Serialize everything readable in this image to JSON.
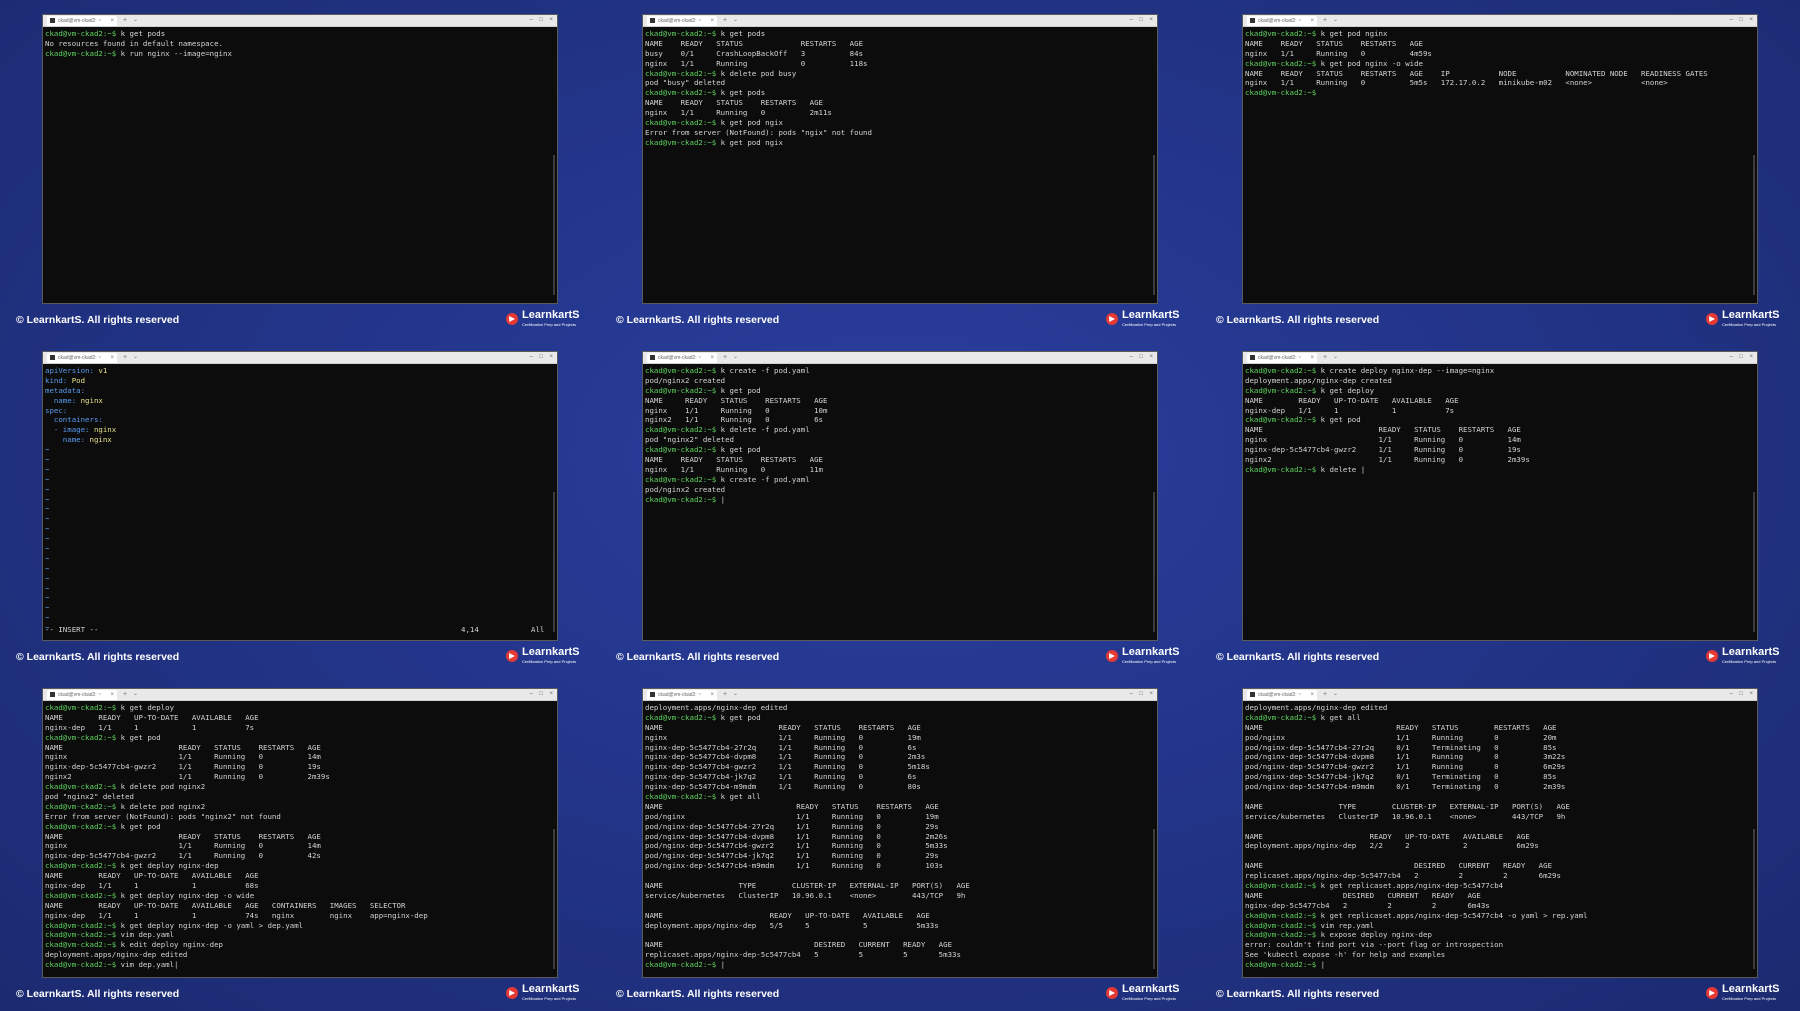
{
  "copyright": "© LearnkartS. All rights reserved",
  "logo": {
    "name": "LearnkartS",
    "tagline": "Certification Prep and Projects"
  },
  "tab_title": "ckad@vm-ckad2: ~",
  "colors": {
    "background": "#23358a",
    "terminal_bg": "#0c0c0c",
    "prompt": "#5fd35f",
    "text": "#d4d4d4"
  },
  "panels": [
    {
      "lines": [
        {
          "p": "ckad@vm-ckad2:~$ ",
          "t": "k get pods"
        },
        {
          "t": "No resources found in default namespace."
        },
        {
          "p": "ckad@vm-ckad2:~$ ",
          "t": "k run nginx --image=nginx"
        }
      ]
    },
    {
      "lines": [
        {
          "p": "ckad@vm-ckad2:~$ ",
          "t": "k get pods"
        },
        {
          "t": "NAME    READY   STATUS             RESTARTS   AGE"
        },
        {
          "t": "busy    0/1     CrashLoopBackOff   3          84s"
        },
        {
          "t": "nginx   1/1     Running            0          118s"
        },
        {
          "p": "ckad@vm-ckad2:~$ ",
          "t": "k delete pod busy"
        },
        {
          "t": "pod \"busy\" deleted"
        },
        {
          "p": "ckad@vm-ckad2:~$ ",
          "t": "k get pods"
        },
        {
          "t": "NAME    READY   STATUS    RESTARTS   AGE"
        },
        {
          "t": "nginx   1/1     Running   0          2m11s"
        },
        {
          "p": "ckad@vm-ckad2:~$ ",
          "t": "k get pod ngix"
        },
        {
          "t": "Error from server (NotFound): pods \"ngix\" not found"
        },
        {
          "p": "ckad@vm-ckad2:~$ ",
          "t": "k get pod ngix"
        }
      ]
    },
    {
      "lines": [
        {
          "p": "ckad@vm-ckad2:~$ ",
          "t": "k get pod nginx"
        },
        {
          "t": "NAME    READY   STATUS    RESTARTS   AGE"
        },
        {
          "t": "nginx   1/1     Running   0          4m59s"
        },
        {
          "p": "ckad@vm-ckad2:~$ ",
          "t": "k get pod nginx -o wide"
        },
        {
          "t": "NAME    READY   STATUS    RESTARTS   AGE    IP           NODE           NOMINATED NODE   READINESS GATES"
        },
        {
          "t": "nginx   1/1     Running   0          5m5s   172.17.0.2   minikube-m02   <none>           <none>"
        },
        {
          "p": "ckad@vm-ckad2:~$ ",
          "t": ""
        }
      ]
    },
    {
      "vim": true,
      "status": "-- INSERT --",
      "position": "4,14",
      "scroll": "All",
      "lines": [
        {
          "k": "apiVersion:",
          "v": " v1"
        },
        {
          "k": "kind:",
          "v": " Pod"
        },
        {
          "k": "metadata:",
          "v": ""
        },
        {
          "k": "  name:",
          "v": " nginx"
        },
        {
          "k": "spec:",
          "v": ""
        },
        {
          "k": "  containers:",
          "v": ""
        },
        {
          "k": "  - image:",
          "v": " nginx"
        },
        {
          "k": "    name:",
          "v": " nginx"
        }
      ],
      "tildes": 19
    },
    {
      "lines": [
        {
          "p": "ckad@vm-ckad2:~$ ",
          "t": "k create -f pod.yaml"
        },
        {
          "t": "pod/nginx2 created"
        },
        {
          "p": "ckad@vm-ckad2:~$ ",
          "t": "k get pod"
        },
        {
          "t": "NAME     READY   STATUS    RESTARTS   AGE"
        },
        {
          "t": "nginx    1/1     Running   0          10m"
        },
        {
          "t": "nginx2   1/1     Running   0          6s"
        },
        {
          "p": "ckad@vm-ckad2:~$ ",
          "t": "k delete -f pod.yaml"
        },
        {
          "t": "pod \"nginx2\" deleted"
        },
        {
          "p": "ckad@vm-ckad2:~$ ",
          "t": "k get pod"
        },
        {
          "t": "NAME    READY   STATUS    RESTARTS   AGE"
        },
        {
          "t": "nginx   1/1     Running   0          11m"
        },
        {
          "p": "ckad@vm-ckad2:~$ ",
          "t": "k create -f pod.yaml"
        },
        {
          "t": "pod/nginx2 created"
        },
        {
          "p": "ckad@vm-ckad2:~$ ",
          "t": "|"
        }
      ]
    },
    {
      "lines": [
        {
          "p": "ckad@vm-ckad2:~$ ",
          "t": "k create deploy nginx-dep --image=nginx"
        },
        {
          "t": "deployment.apps/nginx-dep created"
        },
        {
          "p": "ckad@vm-ckad2:~$ ",
          "t": "k get deploy"
        },
        {
          "t": "NAME        READY   UP-TO-DATE   AVAILABLE   AGE"
        },
        {
          "t": "nginx-dep   1/1     1            1           7s"
        },
        {
          "p": "ckad@vm-ckad2:~$ ",
          "t": "k get pod"
        },
        {
          "t": "NAME                          READY   STATUS    RESTARTS   AGE"
        },
        {
          "t": "nginx                         1/1     Running   0          14m"
        },
        {
          "t": "nginx-dep-5c5477cb4-gwzr2     1/1     Running   0          19s"
        },
        {
          "t": "nginx2                        1/1     Running   0          2m39s"
        },
        {
          "p": "ckad@vm-ckad2:~$ ",
          "t": "k delete |"
        }
      ]
    },
    {
      "lines": [
        {
          "p": "ckad@vm-ckad2:~$ ",
          "t": "k get deploy"
        },
        {
          "t": "NAME        READY   UP-TO-DATE   AVAILABLE   AGE"
        },
        {
          "t": "nginx-dep   1/1     1            1           7s"
        },
        {
          "p": "ckad@vm-ckad2:~$ ",
          "t": "k get pod"
        },
        {
          "t": "NAME                          READY   STATUS    RESTARTS   AGE"
        },
        {
          "t": "nginx                         1/1     Running   0          14m"
        },
        {
          "t": "nginx-dep-5c5477cb4-gwzr2     1/1     Running   0          19s"
        },
        {
          "t": "nginx2                        1/1     Running   0          2m39s"
        },
        {
          "p": "ckad@vm-ckad2:~$ ",
          "t": "k delete pod nginx2"
        },
        {
          "t": "pod \"nginx2\" deleted"
        },
        {
          "p": "ckad@vm-ckad2:~$ ",
          "t": "k delete pod nginx2"
        },
        {
          "t": "Error from server (NotFound): pods \"nginx2\" not found"
        },
        {
          "p": "ckad@vm-ckad2:~$ ",
          "t": "k get pod"
        },
        {
          "t": "NAME                          READY   STATUS    RESTARTS   AGE"
        },
        {
          "t": "nginx                         1/1     Running   0          14m"
        },
        {
          "t": "nginx-dep-5c5477cb4-gwzr2     1/1     Running   0          42s"
        },
        {
          "p": "ckad@vm-ckad2:~$ ",
          "t": "k get deploy nginx-dep"
        },
        {
          "t": "NAME        READY   UP-TO-DATE   AVAILABLE   AGE"
        },
        {
          "t": "nginx-dep   1/1     1            1           68s"
        },
        {
          "p": "ckad@vm-ckad2:~$ ",
          "t": "k get deploy nginx-dep -o wide"
        },
        {
          "t": "NAME        READY   UP-TO-DATE   AVAILABLE   AGE   CONTAINERS   IMAGES   SELECTOR"
        },
        {
          "t": "nginx-dep   1/1     1            1           74s   nginx        nginx    app=nginx-dep"
        },
        {
          "p": "ckad@vm-ckad2:~$ ",
          "t": "k get deploy nginx-dep -o yaml > dep.yaml"
        },
        {
          "p": "ckad@vm-ckad2:~$ ",
          "t": "vim dep.yaml"
        },
        {
          "p": "ckad@vm-ckad2:~$ ",
          "t": "k edit deploy nginx-dep"
        },
        {
          "t": "deployment.apps/nginx-dep edited"
        },
        {
          "p": "ckad@vm-ckad2:~$ ",
          "t": "vim dep.yaml|"
        }
      ]
    },
    {
      "lines": [
        {
          "t": "deployment.apps/nginx-dep edited"
        },
        {
          "p": "ckad@vm-ckad2:~$ ",
          "t": "k get pod"
        },
        {
          "t": "NAME                          READY   STATUS    RESTARTS   AGE"
        },
        {
          "t": "nginx                         1/1     Running   0          19m"
        },
        {
          "t": "nginx-dep-5c5477cb4-27r2q     1/1     Running   0          6s"
        },
        {
          "t": "nginx-dep-5c5477cb4-dvpm8     1/1     Running   0          2m3s"
        },
        {
          "t": "nginx-dep-5c5477cb4-gwzr2     1/1     Running   0          5m18s"
        },
        {
          "t": "nginx-dep-5c5477cb4-jk7q2     1/1     Running   0          6s"
        },
        {
          "t": "nginx-dep-5c5477cb4-m9mdm     1/1     Running   0          80s"
        },
        {
          "p": "ckad@vm-ckad2:~$ ",
          "t": "k get all"
        },
        {
          "t": "NAME                              READY   STATUS    RESTARTS   AGE"
        },
        {
          "t": "pod/nginx                         1/1     Running   0          19m"
        },
        {
          "t": "pod/nginx-dep-5c5477cb4-27r2q     1/1     Running   0          29s"
        },
        {
          "t": "pod/nginx-dep-5c5477cb4-dvpm8     1/1     Running   0          2m26s"
        },
        {
          "t": "pod/nginx-dep-5c5477cb4-gwzr2     1/1     Running   0          5m33s"
        },
        {
          "t": "pod/nginx-dep-5c5477cb4-jk7q2     1/1     Running   0          29s"
        },
        {
          "t": "pod/nginx-dep-5c5477cb4-m9mdm     1/1     Running   0          103s"
        },
        {
          "t": ""
        },
        {
          "t": "NAME                 TYPE        CLUSTER-IP   EXTERNAL-IP   PORT(S)   AGE"
        },
        {
          "t": "service/kubernetes   ClusterIP   10.96.0.1    <none>        443/TCP   9h"
        },
        {
          "t": ""
        },
        {
          "t": "NAME                        READY   UP-TO-DATE   AVAILABLE   AGE"
        },
        {
          "t": "deployment.apps/nginx-dep   5/5     5            5           5m33s"
        },
        {
          "t": ""
        },
        {
          "t": "NAME                                  DESIRED   CURRENT   READY   AGE"
        },
        {
          "t": "replicaset.apps/nginx-dep-5c5477cb4   5         5         5       5m33s"
        },
        {
          "p": "ckad@vm-ckad2:~$ ",
          "t": "|"
        }
      ]
    },
    {
      "lines": [
        {
          "t": "deployment.apps/nginx-dep edited"
        },
        {
          "p": "ckad@vm-ckad2:~$ ",
          "t": "k get all"
        },
        {
          "t": "NAME                              READY   STATUS        RESTARTS   AGE"
        },
        {
          "t": "pod/nginx                         1/1     Running       0          20m"
        },
        {
          "t": "pod/nginx-dep-5c5477cb4-27r2q     0/1     Terminating   0          85s"
        },
        {
          "t": "pod/nginx-dep-5c5477cb4-dvpm8     1/1     Running       0          3m22s"
        },
        {
          "t": "pod/nginx-dep-5c5477cb4-gwzr2     1/1     Running       0          6m29s"
        },
        {
          "t": "pod/nginx-dep-5c5477cb4-jk7q2     0/1     Terminating   0          85s"
        },
        {
          "t": "pod/nginx-dep-5c5477cb4-m9mdm     0/1     Terminating   0          2m39s"
        },
        {
          "t": ""
        },
        {
          "t": "NAME                 TYPE        CLUSTER-IP   EXTERNAL-IP   PORT(S)   AGE"
        },
        {
          "t": "service/kubernetes   ClusterIP   10.96.0.1    <none>        443/TCP   9h"
        },
        {
          "t": ""
        },
        {
          "t": "NAME                        READY   UP-TO-DATE   AVAILABLE   AGE"
        },
        {
          "t": "deployment.apps/nginx-dep   2/2     2            2           6m29s"
        },
        {
          "t": ""
        },
        {
          "t": "NAME                                  DESIRED   CURRENT   READY   AGE"
        },
        {
          "t": "replicaset.apps/nginx-dep-5c5477cb4   2         2         2       6m29s"
        },
        {
          "p": "ckad@vm-ckad2:~$ ",
          "t": "k get replicaset.apps/nginx-dep-5c5477cb4"
        },
        {
          "t": "NAME                  DESIRED   CURRENT   READY   AGE"
        },
        {
          "t": "nginx-dep-5c5477cb4   2         2         2       6m43s"
        },
        {
          "p": "ckad@vm-ckad2:~$ ",
          "t": "k get replicaset.apps/nginx-dep-5c5477cb4 -o yaml > rep.yaml"
        },
        {
          "p": "ckad@vm-ckad2:~$ ",
          "t": "vim rep.yaml"
        },
        {
          "p": "ckad@vm-ckad2:~$ ",
          "t": "k expose deploy nginx-dep"
        },
        {
          "t": "error: couldn't find port via --port flag or introspection"
        },
        {
          "t": "See 'kubectl expose -h' for help and examples"
        },
        {
          "p": "ckad@vm-ckad2:~$ ",
          "t": "|"
        }
      ]
    }
  ]
}
